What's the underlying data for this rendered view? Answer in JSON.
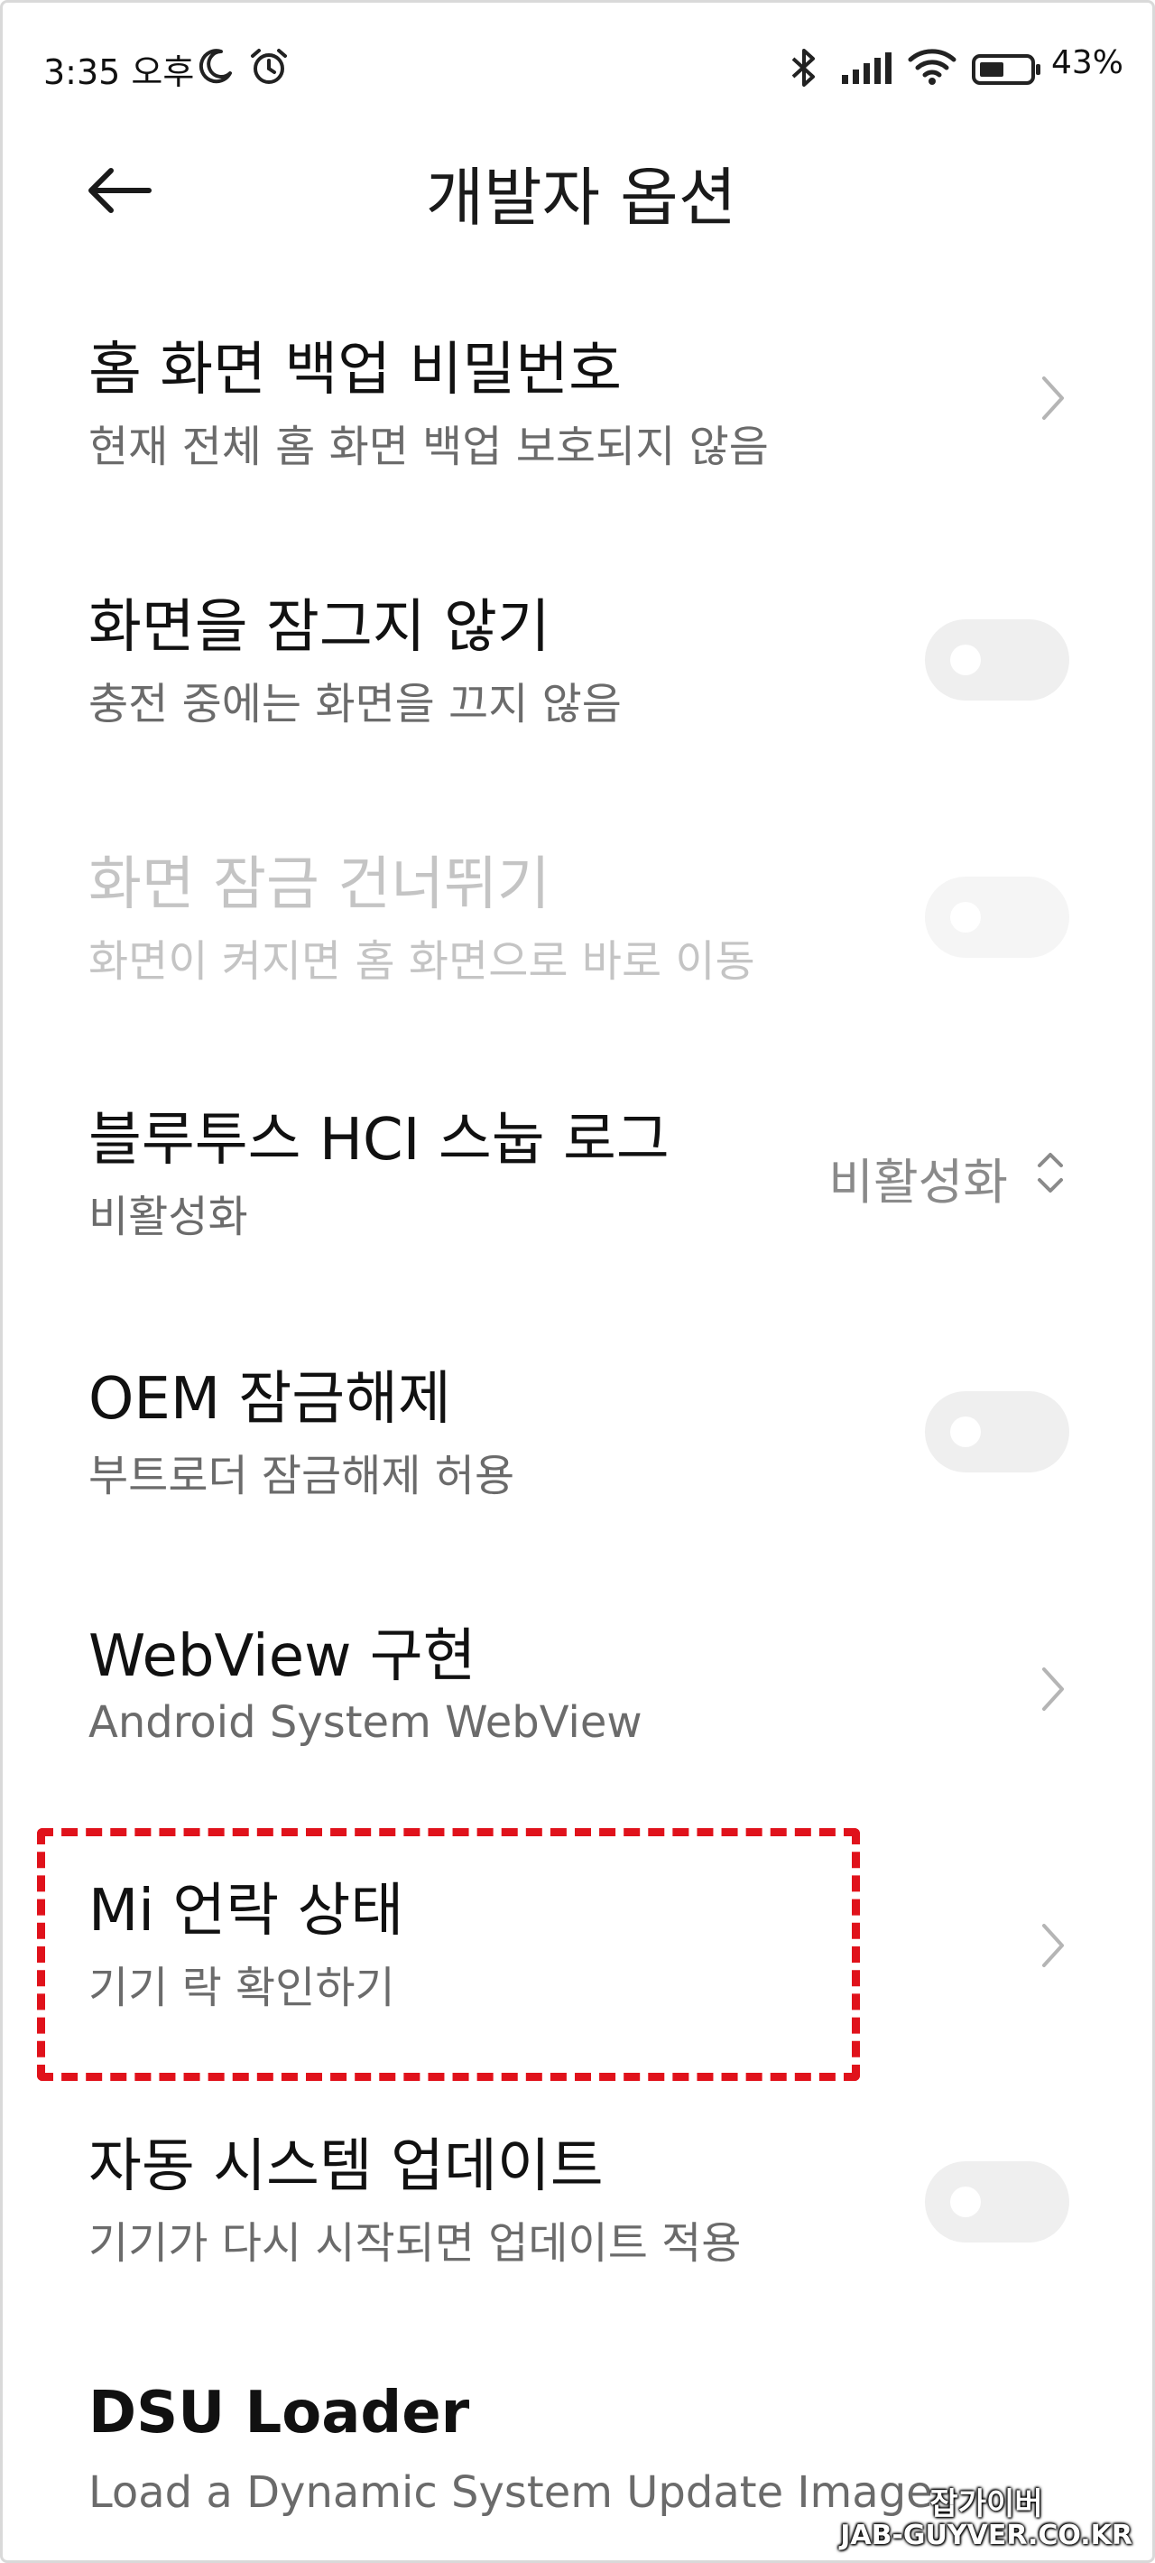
{
  "status_bar": {
    "time": "3:35 오후",
    "battery": "43%",
    "icons": [
      "moon-icon",
      "alarm-icon",
      "bluetooth-icon",
      "signal-icon",
      "wifi-icon",
      "battery-icon"
    ]
  },
  "header": {
    "title": "개발자 옵션",
    "back_icon": "arrow-left-icon"
  },
  "rows": [
    {
      "title": "홈 화면 백업 비밀번호",
      "subtitle": "현재 전체 홈 화면 백업 보호되지 않음",
      "control": "chevron"
    },
    {
      "title": "화면을 잠그지 않기",
      "subtitle": "충전 중에는 화면을 끄지 않음",
      "control": "toggle",
      "on": false
    },
    {
      "title": "화면 잠금 건너뛰기",
      "subtitle": "화면이 켜지면 홈 화면으로 바로 이동",
      "control": "toggle",
      "on": false,
      "disabled": true
    },
    {
      "title": "블루투스 HCI 스눕 로그",
      "subtitle": "비활성화",
      "control": "select",
      "value": "비활성화"
    },
    {
      "title": "OEM 잠금해제",
      "subtitle": "부트로더 잠금해제 허용",
      "control": "toggle",
      "on": false
    },
    {
      "title": "WebView 구현",
      "subtitle": "Android System WebView",
      "control": "chevron"
    },
    {
      "title": "Mi 언락 상태",
      "subtitle": "기기 락 확인하기",
      "control": "chevron",
      "highlighted": true
    },
    {
      "title": "자동 시스템 업데이트",
      "subtitle": "기기가 다시 시작되면 업데이트 적용",
      "control": "toggle",
      "on": false
    },
    {
      "title": "DSU Loader",
      "subtitle": "Load a Dynamic System Update Image",
      "control": "none"
    }
  ],
  "highlight_color": "#e0121b",
  "watermark": {
    "line1": "잡가이버",
    "line2": "JAB-GUYVER.CO.KR"
  }
}
